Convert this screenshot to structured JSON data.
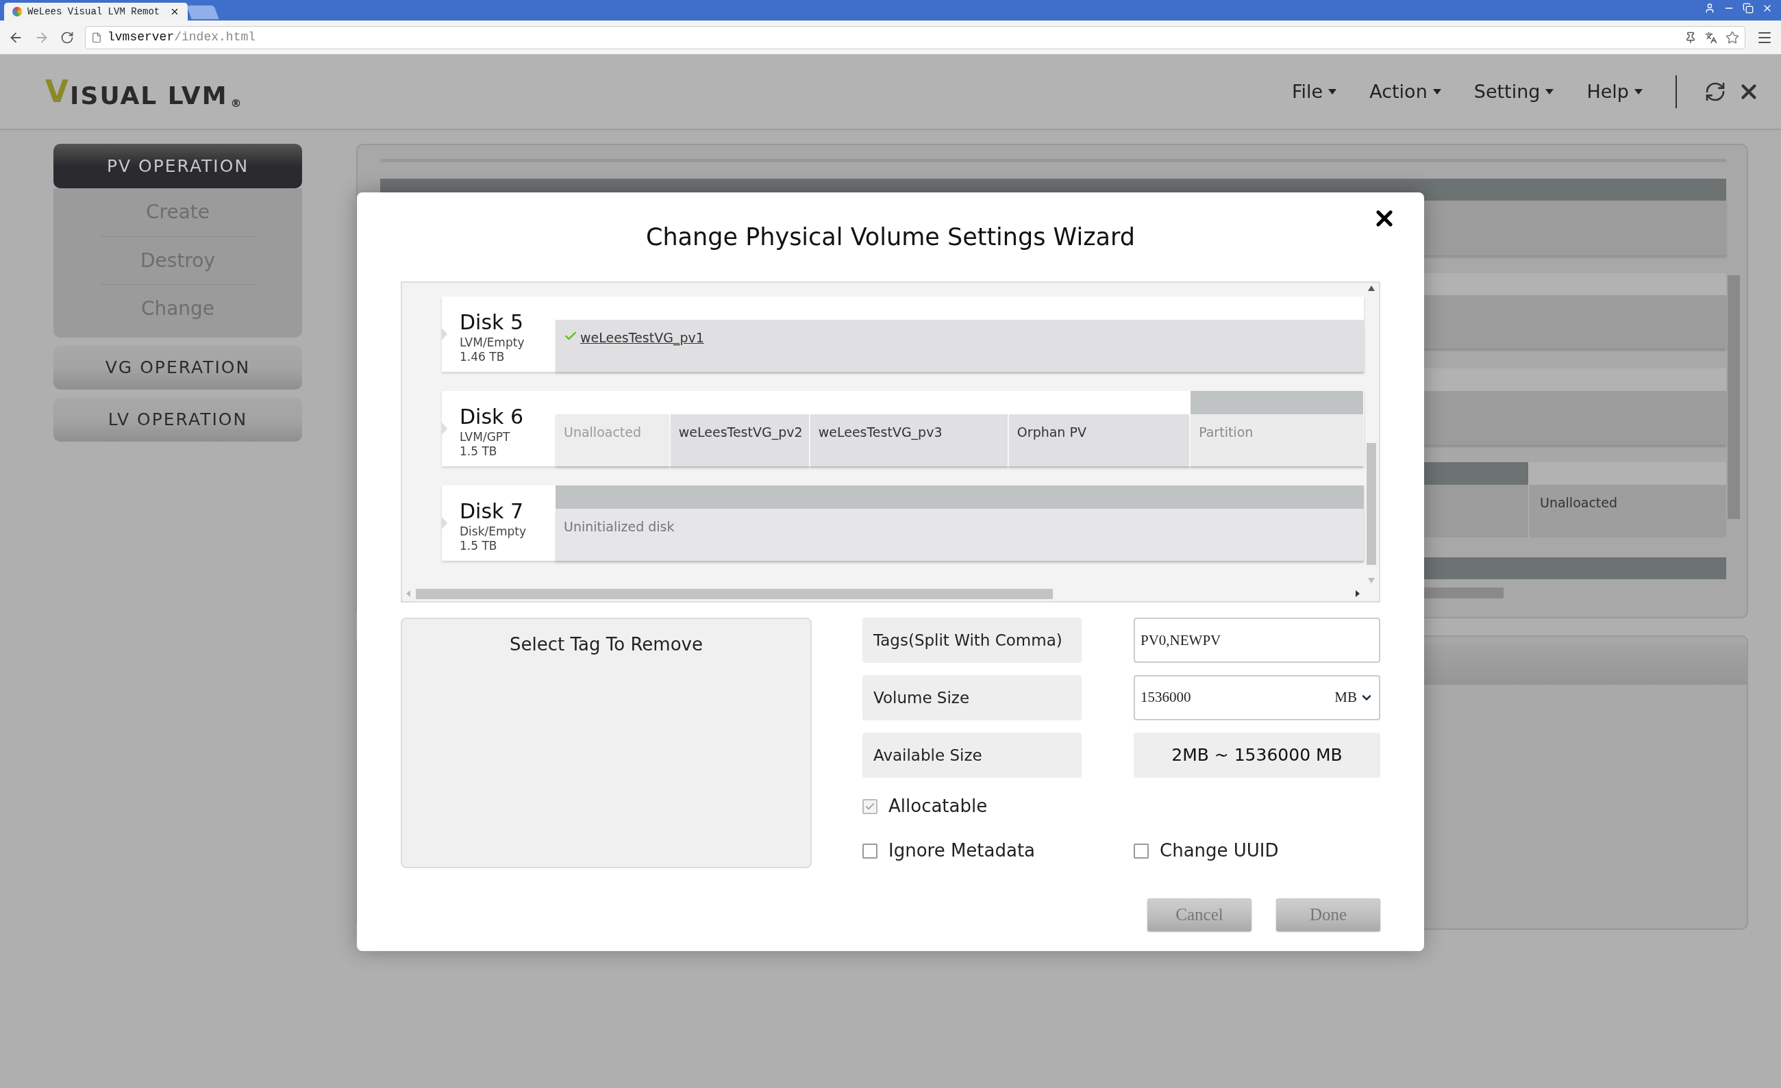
{
  "browser": {
    "tab_title": "WeLees Visual LVM Remot",
    "url_host": "lvmserver",
    "url_path": "/index.html"
  },
  "header": {
    "logo": "VISUAL LVM",
    "logo_mark": "®",
    "menus": [
      "File",
      "Action",
      "Setting",
      "Help"
    ]
  },
  "sidebar": [
    {
      "title": "PV OPERATION",
      "expanded": true,
      "items": [
        "Create",
        "Destroy",
        "Change"
      ]
    },
    {
      "title": "VG OPERATION",
      "expanded": false
    },
    {
      "title": "LV OPERATION",
      "expanded": false
    }
  ],
  "background": {
    "segment_label": "Unalloacted"
  },
  "dialog": {
    "title": "Change Physical Volume Settings Wizard",
    "disks": [
      {
        "name": "Disk 5",
        "type": "LVM/Empty",
        "size": "1.46 TB",
        "partitions": [
          {
            "label": "weLeesTestVG_pv1",
            "kind": "volume",
            "selected": true
          }
        ]
      },
      {
        "name": "Disk 6",
        "type": "LVM/GPT",
        "size": "1.5 TB",
        "partitions": [
          {
            "label": "Unalloacted",
            "kind": "unallocated",
            "selected": false
          },
          {
            "label": "weLeesTestVG_pv2",
            "kind": "volume",
            "selected": false
          },
          {
            "label": "weLeesTestVG_pv3",
            "kind": "volume",
            "selected": false
          },
          {
            "label": "Orphan PV",
            "kind": "volume",
            "selected": false
          },
          {
            "label": "Partition",
            "kind": "partition",
            "selected": false
          }
        ]
      },
      {
        "name": "Disk 7",
        "type": "Disk/Empty",
        "size": "1.5 TB",
        "partitions": [
          {
            "label": "Uninitialized disk",
            "kind": "uninitialized",
            "selected": false
          }
        ]
      }
    ],
    "tag_list": {
      "title": "Select Tag To Remove"
    },
    "fields": [
      {
        "label": "Tags(Split With Comma)",
        "kind": "input",
        "value": "PV0,NEWPV"
      },
      {
        "label": "Volume Size",
        "kind": "select",
        "value": "1536000",
        "unit": "MB"
      },
      {
        "label": "Available Size",
        "kind": "readout",
        "value": "2MB ~ 1536000 MB"
      }
    ],
    "checkboxes": [
      {
        "label": "Allocatable",
        "checked": true
      },
      {
        "label": "Ignore Metadata",
        "checked": false
      },
      {
        "label": "Change UUID",
        "checked": false
      }
    ],
    "buttons": [
      "Cancel",
      "Done"
    ]
  }
}
